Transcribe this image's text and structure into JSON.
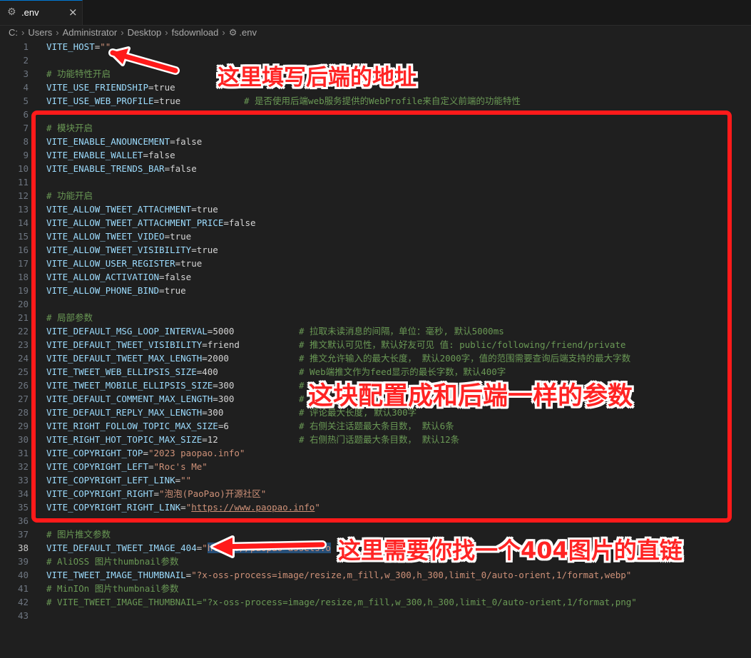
{
  "tab": {
    "icon": "gear-icon",
    "name": ".env",
    "close": "×"
  },
  "breadcrumb": [
    "C:",
    "Users",
    "Administrator",
    "Desktop",
    "fsdownload",
    ".env"
  ],
  "lines": [
    {
      "n": "1",
      "tokens": [
        [
          "k",
          "VITE_HOST"
        ],
        [
          "e",
          "="
        ],
        [
          "s",
          "\"\""
        ]
      ]
    },
    {
      "n": "2",
      "tokens": []
    },
    {
      "n": "3",
      "tokens": [
        [
          "c",
          "# 功能特性开启"
        ]
      ]
    },
    {
      "n": "4",
      "tokens": [
        [
          "k",
          "VITE_USE_FRIENDSHIP"
        ],
        [
          "e",
          "="
        ],
        [
          "v",
          "true"
        ]
      ]
    },
    {
      "n": "5",
      "tokens": [
        [
          "k",
          "VITE_USE_WEB_PROFILE"
        ],
        [
          "e",
          "="
        ],
        [
          "v",
          "true"
        ]
      ],
      "comment": "# 是否使用后端web服务提供的WebProfile来自定义前端的功能特性",
      "ccol": 342
    },
    {
      "n": "6",
      "tokens": []
    },
    {
      "n": "7",
      "tokens": [
        [
          "c",
          "# 模块开启"
        ]
      ]
    },
    {
      "n": "8",
      "tokens": [
        [
          "k",
          "VITE_ENABLE_ANOUNCEMENT"
        ],
        [
          "e",
          "="
        ],
        [
          "v",
          "false"
        ]
      ]
    },
    {
      "n": "9",
      "tokens": [
        [
          "k",
          "VITE_ENABLE_WALLET"
        ],
        [
          "e",
          "="
        ],
        [
          "v",
          "false"
        ]
      ]
    },
    {
      "n": "10",
      "tokens": [
        [
          "k",
          "VITE_ENABLE_TRENDS_BAR"
        ],
        [
          "e",
          "="
        ],
        [
          "v",
          "false"
        ]
      ]
    },
    {
      "n": "11",
      "tokens": []
    },
    {
      "n": "12",
      "tokens": [
        [
          "c",
          "# 功能开启"
        ]
      ]
    },
    {
      "n": "13",
      "tokens": [
        [
          "k",
          "VITE_ALLOW_TWEET_ATTACHMENT"
        ],
        [
          "e",
          "="
        ],
        [
          "v",
          "true"
        ]
      ]
    },
    {
      "n": "14",
      "tokens": [
        [
          "k",
          "VITE_ALLOW_TWEET_ATTACHMENT_PRICE"
        ],
        [
          "e",
          "="
        ],
        [
          "v",
          "false"
        ]
      ]
    },
    {
      "n": "15",
      "tokens": [
        [
          "k",
          "VITE_ALLOW_TWEET_VIDEO"
        ],
        [
          "e",
          "="
        ],
        [
          "v",
          "true"
        ]
      ]
    },
    {
      "n": "16",
      "tokens": [
        [
          "k",
          "VITE_ALLOW_TWEET_VISIBILITY"
        ],
        [
          "e",
          "="
        ],
        [
          "v",
          "true"
        ]
      ]
    },
    {
      "n": "17",
      "tokens": [
        [
          "k",
          "VITE_ALLOW_USER_REGISTER"
        ],
        [
          "e",
          "="
        ],
        [
          "v",
          "true"
        ]
      ]
    },
    {
      "n": "18",
      "tokens": [
        [
          "k",
          "VITE_ALLOW_ACTIVATION"
        ],
        [
          "e",
          "="
        ],
        [
          "v",
          "false"
        ]
      ]
    },
    {
      "n": "19",
      "tokens": [
        [
          "k",
          "VITE_ALLOW_PHONE_BIND"
        ],
        [
          "e",
          "="
        ],
        [
          "v",
          "true"
        ]
      ]
    },
    {
      "n": "20",
      "tokens": []
    },
    {
      "n": "21",
      "tokens": [
        [
          "c",
          "# 局部参数"
        ]
      ]
    },
    {
      "n": "22",
      "tokens": [
        [
          "k",
          "VITE_DEFAULT_MSG_LOOP_INTERVAL"
        ],
        [
          "e",
          "="
        ],
        [
          "v",
          "5000"
        ]
      ],
      "comment": "# 拉取未读消息的间隔，单位：毫秒, 默认5000ms",
      "ccol": 419
    },
    {
      "n": "23",
      "tokens": [
        [
          "k",
          "VITE_DEFAULT_TWEET_VISIBILITY"
        ],
        [
          "e",
          "="
        ],
        [
          "v",
          "friend"
        ]
      ],
      "comment": "# 推文默认可见性，默认好友可见 值: public/following/friend/private",
      "ccol": 419
    },
    {
      "n": "24",
      "tokens": [
        [
          "k",
          "VITE_DEFAULT_TWEET_MAX_LENGTH"
        ],
        [
          "e",
          "="
        ],
        [
          "v",
          "2000"
        ]
      ],
      "comment": "# 推文允许输入的最大长度， 默认2000字，值的范围需要查询后端支持的最大字数",
      "ccol": 419
    },
    {
      "n": "25",
      "tokens": [
        [
          "k",
          "VITE_TWEET_WEB_ELLIPSIS_SIZE"
        ],
        [
          "e",
          "="
        ],
        [
          "v",
          "400"
        ]
      ],
      "comment": "# Web端推文作为feed显示的最长字数，默认400字",
      "ccol": 419
    },
    {
      "n": "26",
      "tokens": [
        [
          "k",
          "VITE_TWEET_MOBILE_ELLIPSIS_SIZE"
        ],
        [
          "e",
          "="
        ],
        [
          "v",
          "300"
        ]
      ],
      "comment": "#",
      "ccol": 419
    },
    {
      "n": "27",
      "tokens": [
        [
          "k",
          "VITE_DEFAULT_COMMENT_MAX_LENGTH"
        ],
        [
          "e",
          "="
        ],
        [
          "v",
          "300"
        ]
      ],
      "comment": "#",
      "ccol": 419
    },
    {
      "n": "28",
      "tokens": [
        [
          "k",
          "VITE_DEFAULT_REPLY_MAX_LENGTH"
        ],
        [
          "e",
          "="
        ],
        [
          "v",
          "300"
        ]
      ],
      "comment": "# 评论最大长度, 默认300字",
      "ccol": 419
    },
    {
      "n": "29",
      "tokens": [
        [
          "k",
          "VITE_RIGHT_FOLLOW_TOPIC_MAX_SIZE"
        ],
        [
          "e",
          "="
        ],
        [
          "v",
          "6"
        ]
      ],
      "comment": "# 右侧关注话题最大条目数， 默认6条",
      "ccol": 419
    },
    {
      "n": "30",
      "tokens": [
        [
          "k",
          "VITE_RIGHT_HOT_TOPIC_MAX_SIZE"
        ],
        [
          "e",
          "="
        ],
        [
          "v",
          "12"
        ]
      ],
      "comment": "# 右侧热门话题最大条目数， 默认12条",
      "ccol": 419
    },
    {
      "n": "31",
      "tokens": [
        [
          "k",
          "VITE_COPYRIGHT_TOP"
        ],
        [
          "e",
          "="
        ],
        [
          "s",
          "\"2023 paopao.info\""
        ]
      ]
    },
    {
      "n": "32",
      "tokens": [
        [
          "k",
          "VITE_COPYRIGHT_LEFT"
        ],
        [
          "e",
          "="
        ],
        [
          "s",
          "\"Roc's Me\""
        ]
      ]
    },
    {
      "n": "33",
      "tokens": [
        [
          "k",
          "VITE_COPYRIGHT_LEFT_LINK"
        ],
        [
          "e",
          "="
        ],
        [
          "s",
          "\"\""
        ]
      ]
    },
    {
      "n": "34",
      "tokens": [
        [
          "k",
          "VITE_COPYRIGHT_RIGHT"
        ],
        [
          "e",
          "="
        ],
        [
          "s",
          "\"泡泡(PaoPao)开源社区\""
        ]
      ]
    },
    {
      "n": "35",
      "tokens": [
        [
          "k",
          "VITE_COPYRIGHT_RIGHT_LINK"
        ],
        [
          "e",
          "="
        ],
        [
          "s",
          "\""
        ],
        [
          "su",
          "https://www.paopao.info"
        ],
        [
          "s",
          "\""
        ]
      ]
    },
    {
      "n": "36",
      "tokens": []
    },
    {
      "n": "37",
      "tokens": [
        [
          "c",
          "# 图片推文参数"
        ]
      ]
    },
    {
      "n": "38",
      "tokens": [
        [
          "k",
          "VITE_DEFAULT_TWEET_IMAGE_404"
        ],
        [
          "e",
          "="
        ],
        [
          "s",
          "\""
        ],
        [
          "sel",
          "https://paopao-assets.o"
        ]
      ],
      "active": true
    },
    {
      "n": "39",
      "tokens": [
        [
          "c",
          "# AliOSS 图片thumbnail参数"
        ]
      ]
    },
    {
      "n": "40",
      "tokens": [
        [
          "k",
          "VITE_TWEET_IMAGE_THUMBNAIL"
        ],
        [
          "e",
          "="
        ],
        [
          "s",
          "\"?x-oss-process=image/resize,m_fill,w_300,h_300,limit_0/auto-orient,1/format,webp\""
        ]
      ]
    },
    {
      "n": "41",
      "tokens": [
        [
          "c",
          "# MinIOn 图片thumbnail参数"
        ]
      ]
    },
    {
      "n": "42",
      "tokens": [
        [
          "c",
          "# VITE_TWEET_IMAGE_THUMBNAIL=\"?x-oss-process=image/resize,m_fill,w_300,h_300,limit_0/auto-orient,1/format,png\""
        ]
      ]
    },
    {
      "n": "43",
      "tokens": []
    }
  ],
  "annotations": {
    "host": "这里填写后端的地址",
    "block": "这块配置成和后端一样的参数",
    "image404": "这里需要你找一个404图片的直链"
  }
}
